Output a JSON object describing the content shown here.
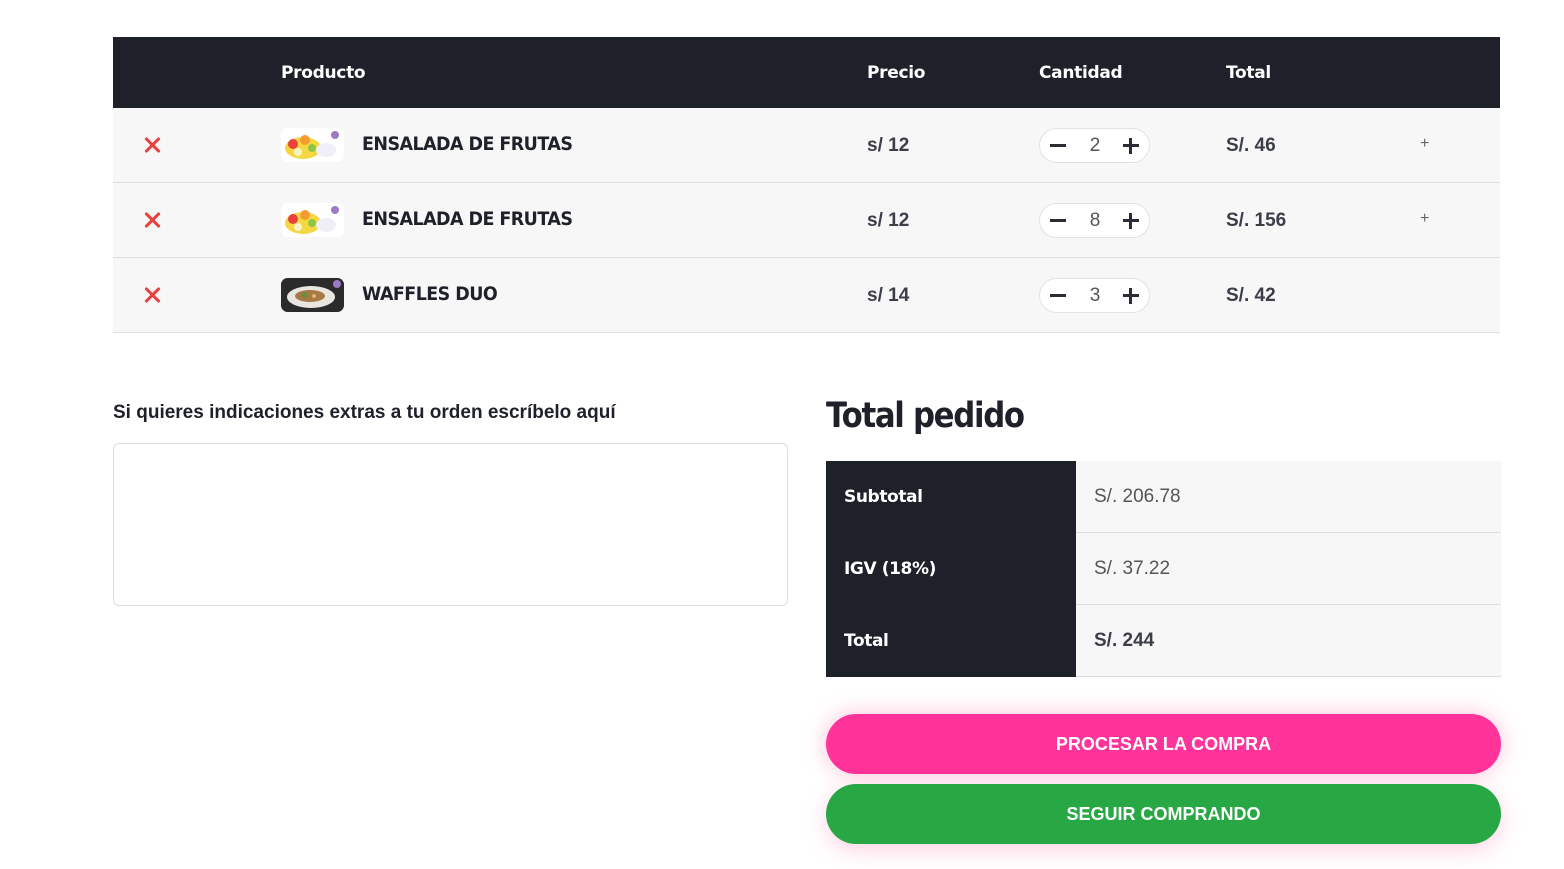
{
  "table": {
    "headers": {
      "product": "Producto",
      "price": "Precio",
      "quantity": "Cantidad",
      "total": "Total"
    },
    "rows": [
      {
        "name": "ENSALADA DE FRUTAS",
        "price": "s/ 12",
        "quantity": "2",
        "total": "S/. 46",
        "expand": "+"
      },
      {
        "name": "ENSALADA DE FRUTAS",
        "price": "s/ 12",
        "quantity": "8",
        "total": "S/. 156",
        "expand": "+"
      },
      {
        "name": "WAFFLES DUO",
        "price": "s/ 14",
        "quantity": "3",
        "total": "S/. 42",
        "expand": ""
      }
    ]
  },
  "notes": {
    "label": "Si quieres indicaciones extras a tu orden escríbelo aquí",
    "value": ""
  },
  "summary": {
    "title": "Total pedido",
    "subtotal_label": "Subtotal",
    "subtotal_value": "S/. 206.78",
    "igv_label": "IGV (18%)",
    "igv_value": "S/. 37.22",
    "total_label": "Total",
    "total_value": "S/. 244"
  },
  "buttons": {
    "process": "PROCESAR LA COMPRA",
    "continue": "SEGUIR COMPRANDO"
  },
  "colors": {
    "header_bg": "#1e2129",
    "remove": "#e8413e",
    "process_btn": "#ff3399",
    "continue_btn": "#27a845"
  },
  "icons": {
    "remove": "close-icon",
    "decrement": "minus-icon",
    "increment": "plus-icon"
  }
}
